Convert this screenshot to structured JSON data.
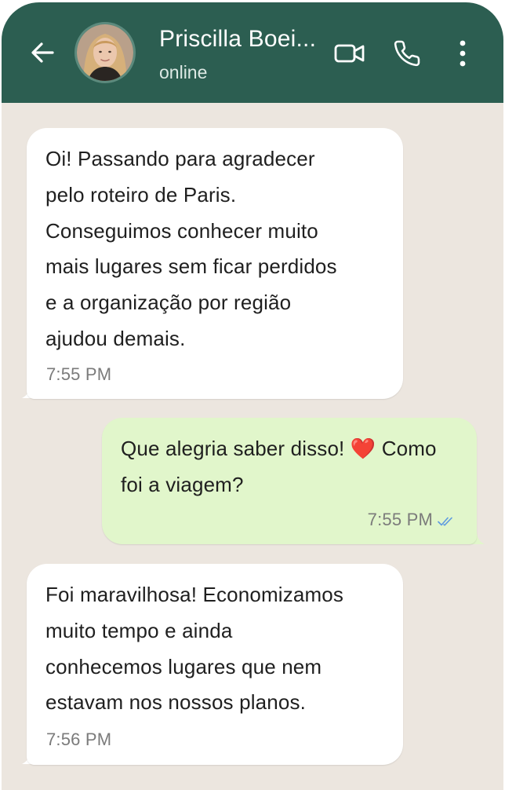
{
  "header": {
    "contact_name": "Priscilla Boei...",
    "status": "online",
    "icons": [
      "back-arrow-icon",
      "video-call-icon",
      "phone-call-icon",
      "more-options-icon"
    ],
    "background_color": "#2c5e51"
  },
  "chat": {
    "background_color": "#ece6df",
    "messages": [
      {
        "direction": "incoming",
        "lines": [
          "Oi! Passando para agradecer",
          "pelo roteiro de Paris.",
          "Conseguimos conhecer muito",
          "mais lugares sem ficar perdidos",
          "e a organização por região",
          "ajudou demais."
        ],
        "time": "7:55 PM"
      },
      {
        "direction": "outgoing",
        "lines": [
          "Que alegria saber disso! ❤️ Como",
          "foi a viagem?"
        ],
        "time": "7:55 PM",
        "status_icon": "double-check-icon",
        "bubble_color": "#e1f6cb"
      },
      {
        "direction": "incoming",
        "lines": [
          "Foi maravilhosa! Economizamos",
          "muito tempo e ainda",
          "conhecemos lugares que nem",
          "estavam nos nossos planos."
        ],
        "time": "7:56 PM"
      }
    ]
  }
}
